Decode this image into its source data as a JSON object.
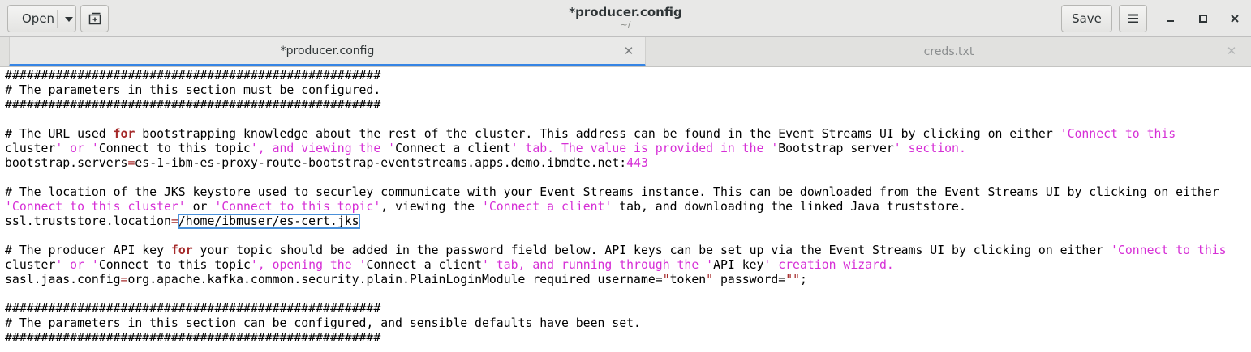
{
  "window": {
    "title": "*producer.config",
    "subtitle": "~/",
    "open_label": "Open",
    "save_label": "Save"
  },
  "tabs": [
    {
      "label": "*producer.config",
      "active": true
    },
    {
      "label": "creds.txt",
      "active": false
    }
  ],
  "icons": {
    "new_tab": "new-tab-icon",
    "menu": "hamburger-menu-icon",
    "minimize": "minimize-icon",
    "maximize": "maximize-icon",
    "close": "close-icon",
    "tab_close": "tab-close-icon"
  },
  "colors": {
    "keyword": "#a52a2a",
    "string": "#d62fd6",
    "tab_accent": "#3584e4",
    "highlight_box": "#4a90d9"
  },
  "editor": {
    "lines": [
      "####################################################",
      "# The parameters in this section must be configured.",
      "####################################################",
      "",
      "# The URL used for bootstrapping knowledge about the rest of the cluster. This address can be found in the Event Streams UI by clicking on either 'Connect to this",
      "cluster' or 'Connect to this topic', and viewing the 'Connect a client' tab. The value is provided in the 'Bootstrap server' section.",
      "bootstrap.servers=es-1-ibm-es-proxy-route-bootstrap-eventstreams.apps.demo.ibmdte.net:443",
      "",
      "# The location of the JKS keystore used to securley communicate with your Event Streams instance. This can be downloaded from the Event Streams UI by clicking on either",
      "'Connect to this cluster' or 'Connect to this topic', viewing the 'Connect a client' tab, and downloading the linked Java truststore.",
      "ssl.truststore.location=/home/ibmuser/es-cert.jks",
      "",
      "# The producer API key for your topic should be added in the password field below. API keys can be set up via the Event Streams UI by clicking on either 'Connect to this",
      "cluster' or 'Connect to this topic', opening the 'Connect a client' tab, and running through the 'API key' creation wizard.",
      "sasl.jaas.config=org.apache.kafka.common.security.plain.PlainLoginModule required username=\"token\" password=\"\";",
      "",
      "####################################################",
      "# The parameters in this section can be configured, and sensible defaults have been set.",
      "####################################################"
    ],
    "keywords": [
      "for"
    ],
    "highlighted_value": "/home/ibmuser/es-cert.jks"
  }
}
